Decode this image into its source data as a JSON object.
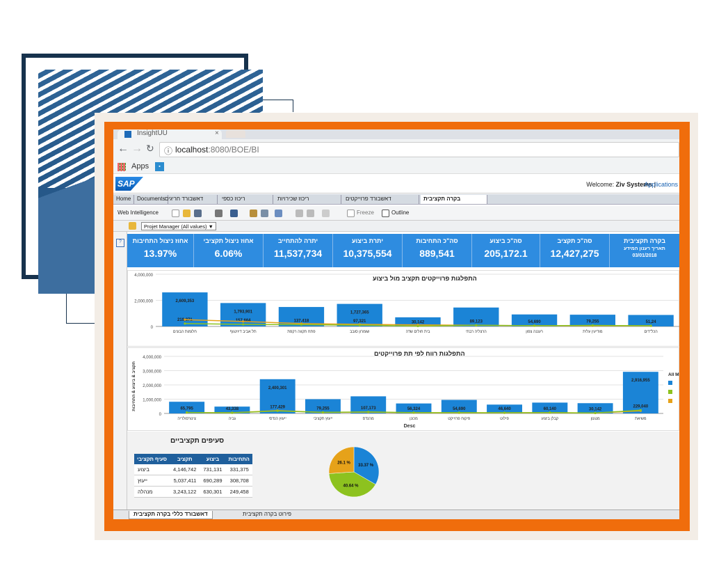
{
  "browser": {
    "tab_title": "InsightUU",
    "url_host": "localhost",
    "url_rest": ":8080/BOE/BI",
    "bookmark_apps": "Apps"
  },
  "header": {
    "logo": "SAP",
    "welcome": "Welcome:",
    "user": "Ziv Systems",
    "applications": "Applications"
  },
  "doc_tabs": [
    "Home",
    "Documents",
    "דאשבורד חריגים",
    "ריכוז כספי",
    "ריכוז שכירויות",
    "דאשבורד פרוייקטים",
    "בקרה תקציבית"
  ],
  "toolbar": {
    "web_intelligence": "Web Intelligence",
    "freeze": "Freeze",
    "outline": "Outline"
  },
  "filter": {
    "label": "Projet Manager (All values)"
  },
  "kpis": [
    {
      "title": "אחוז ניצול התחיבות",
      "value": "13.97%"
    },
    {
      "title": "אחוז ניצול תקציבי",
      "value": "6.06%"
    },
    {
      "title": "יתרה להתחייב",
      "value": "11,537,734"
    },
    {
      "title": "יתרת ביצוע",
      "value": "10,375,554"
    },
    {
      "title": "סה\"כ התחיבות",
      "value": "889,541"
    },
    {
      "title": "סה\"כ ביצוע",
      "value": "205,172.1"
    },
    {
      "title": "סה\"כ תקציב",
      "value": "12,427,275"
    },
    {
      "title": "בקרה תקציבית",
      "sub1": "תאריך רענון המידע",
      "sub2": "03/01/2018"
    }
  ],
  "colors": {
    "kpi_bg": "#2e8ce0",
    "bar": "#1b84d6",
    "line_green": "#8dc21f",
    "line_orange": "#e6a21a",
    "frame_orange": "#f06d0c",
    "deco_navy": "#17324d"
  },
  "chart_data": [
    {
      "type": "bar",
      "title": "התפלגות פרוייקטים תקציב מול ביצוע",
      "categories": [
        "חלומות הבונים",
        "תל אביב דיזינגוף",
        "פתח תקווה רקפת",
        "שומרון סובב",
        "בית חולים שדה",
        "הרצליה רבתי",
        "רעננה צפון",
        "מודיעין עלית",
        "הכל\"דים"
      ],
      "ylim": [
        0,
        4000000
      ],
      "ticks": [
        "0",
        "2,000,000",
        "4,000,000"
      ],
      "series": [
        {
          "values": [
            2609353,
            1793901,
            1490000,
            1727365,
            700000,
            1450000,
            920000,
            900000,
            880000
          ],
          "labels": [
            "2,609,353",
            "1,793,901",
            "",
            "1,727,365",
            "",
            "",
            "",
            "",
            ""
          ]
        },
        {
          "values": [
            219000,
            157000,
            137000,
            97000,
            30000,
            89000,
            55000,
            79000,
            51000
          ],
          "labels": [
            "219,871",
            "157,664",
            "137,418",
            "97,321",
            "30,142",
            "89,123",
            "54,690",
            "79,255",
            "51,24"
          ]
        },
        {
          "values": [
            520000,
            380000,
            220000,
            160000,
            120000,
            90000,
            60000,
            50000,
            45000
          ],
          "labels": []
        }
      ]
    },
    {
      "type": "bar",
      "title": "התפלגות רווח לפי תת פרוייקטים",
      "xlabel": "Desc",
      "ylabel": "תקציב & ביצוע & התחיבות",
      "categories": [
        "צינורסולריה",
        "גביה",
        "ייעוץ הנדסי",
        "ייעוץ תקציבי",
        "מהנדס",
        "מכונן",
        "פיקוח פרוייקט",
        "פילוט",
        "קבלן ביצוע",
        "מנגנון",
        "משיאת"
      ],
      "ylim": [
        0,
        4000000
      ],
      "ticks": [
        "0",
        "1,000,000",
        "2,000,000",
        "3,000,000",
        "4,000,000"
      ],
      "legend_title": "All M",
      "series": [
        {
          "values": [
            820000,
            480000,
            2400301,
            1000000,
            1200000,
            700000,
            950000,
            620000,
            760000,
            720000,
            2916955
          ],
          "labels": [
            "",
            "",
            "2,400,301",
            "",
            "",
            "",
            "",
            "",
            "",
            "",
            "2,916,955"
          ]
        },
        {
          "values": [
            65795,
            43338,
            177429,
            79255,
            107173,
            56324,
            54690,
            46640,
            60140,
            30142,
            229040
          ],
          "labels": [
            "65,795",
            "43,338",
            "177,429",
            "79,255",
            "107,173",
            "56,324",
            "54,690",
            "46,640",
            "60,140",
            "30,142",
            "229,040"
          ]
        },
        {
          "values": [
            60000,
            50000,
            200000,
            70000,
            90000,
            50000,
            40000,
            40000,
            50000,
            30000,
            180000
          ],
          "labels": []
        }
      ]
    },
    {
      "type": "pie",
      "slices": [
        {
          "label": "33.37 %",
          "value": 33.37,
          "color": "#1b84d6"
        },
        {
          "label": "40.64 %",
          "value": 40.64,
          "color": "#8dc21f"
        },
        {
          "label": "26.1 %",
          "value": 26.1,
          "color": "#e6a21a"
        }
      ]
    }
  ],
  "budget_table": {
    "title": "סעיפים תקציביים",
    "headers": [
      "סעיף תקציבי",
      "תקציב",
      "ביצוע",
      "התחיבות"
    ],
    "rows": [
      [
        "ביצוע",
        "4,146,742",
        "731,131",
        "331,375"
      ],
      [
        "ייעוץ",
        "5,037,411",
        "690,289",
        "308,708"
      ],
      [
        "מנהלה",
        "3,243,122",
        "630,301",
        "249,458"
      ]
    ]
  },
  "sheet_tabs": [
    "דאשבורד כללי בקרה תקציבית",
    "פירוט בקרה תקציבית"
  ]
}
